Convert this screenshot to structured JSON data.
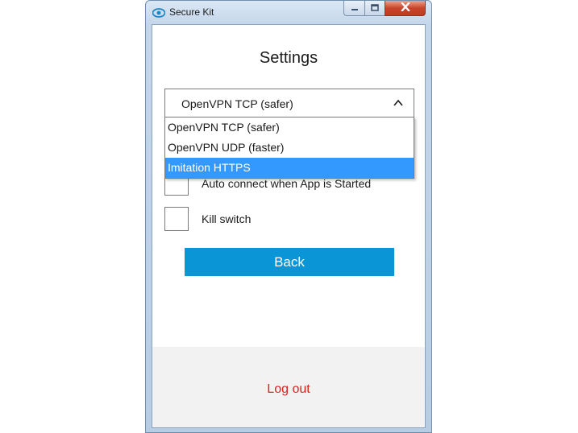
{
  "window": {
    "title": "Secure Kit"
  },
  "settings": {
    "heading": "Settings",
    "protocol": {
      "selected": "OpenVPN TCP (safer)",
      "options": [
        {
          "label": "OpenVPN TCP (safer)",
          "highlighted": false
        },
        {
          "label": "OpenVPN UDP (faster)",
          "highlighted": false
        },
        {
          "label": "Imitation HTTPS",
          "highlighted": true
        }
      ]
    },
    "auto_connect_label": "Auto connect when App is Started",
    "kill_switch_label": "Kill switch",
    "back_label": "Back",
    "logout_label": "Log out"
  },
  "colors": {
    "accent": "#0a96d6",
    "highlight": "#3399ff",
    "logout": "#e02020"
  },
  "icons": {
    "app": "eye-icon",
    "chevron": "chevron-up-icon"
  }
}
